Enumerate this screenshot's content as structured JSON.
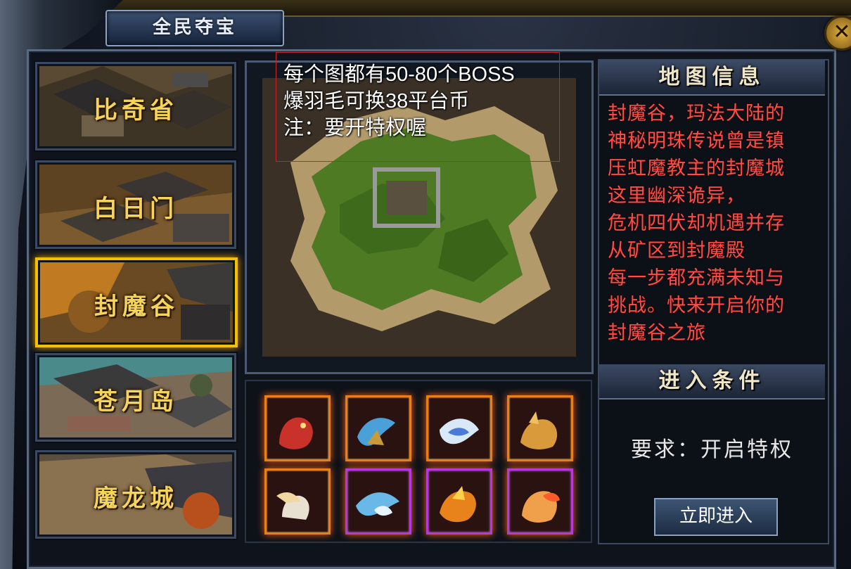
{
  "top_tabs": [
    "",
    "",
    "",
    "",
    ""
  ],
  "window": {
    "title": "全民夺宝",
    "close_label": "✕"
  },
  "maps": [
    {
      "name": "比奇省",
      "selected": false
    },
    {
      "name": "白日门",
      "selected": false
    },
    {
      "name": "封魔谷",
      "selected": true
    },
    {
      "name": "苍月岛",
      "selected": false
    },
    {
      "name": "魔龙城",
      "selected": false
    }
  ],
  "notice": {
    "line1": "每个图都有50-80个BOSS",
    "line2": "爆羽毛可换38平台币",
    "line3": "注：要开特权喔"
  },
  "rewards": {
    "items": [
      {
        "icon": "red-beast-icon",
        "frame": "orange"
      },
      {
        "icon": "blue-beast-icon",
        "frame": "orange"
      },
      {
        "icon": "white-bird-icon",
        "frame": "orange"
      },
      {
        "icon": "golden-beast-icon",
        "frame": "orange"
      },
      {
        "icon": "white-horse-icon",
        "frame": "orange"
      },
      {
        "icon": "blue-phoenix-icon",
        "frame": "purple"
      },
      {
        "icon": "fire-phoenix-icon",
        "frame": "purple"
      },
      {
        "icon": "fire-fox-icon",
        "frame": "purple"
      }
    ]
  },
  "info": {
    "title": "地图信息",
    "description": [
      "封魔谷，玛法大陆的",
      "神秘明珠传说曾是镇",
      "压虹魔教主的封魔城",
      "这里幽深诡异，",
      "危机四伏却机遇并存",
      "从矿区到封魔殿",
      "每一步都充满未知与",
      "挑战。快来开启你的",
      "封魔谷之旅"
    ],
    "conditions_title": "进入条件",
    "requirement": "要求：开启特权",
    "enter_label": "立即进入"
  },
  "colors": {
    "accent_gold": "#f2c200",
    "description_red": "#ff4d46",
    "notice_border": "#c8262a"
  }
}
